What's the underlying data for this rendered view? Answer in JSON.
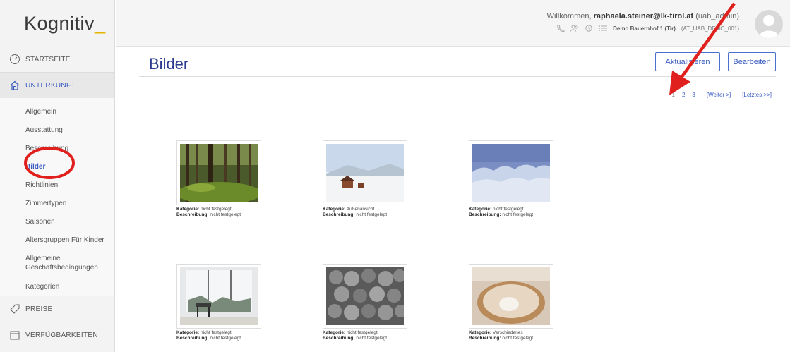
{
  "app": {
    "logo_text": "Kognitiv",
    "logo_accent": "_"
  },
  "sidebar": {
    "main_items": [
      {
        "label": "STARTSEITE",
        "icon": "gauge-icon"
      },
      {
        "label": "UNTERKUNFT",
        "icon": "home-icon"
      }
    ],
    "sub_items": [
      "Allgemein",
      "Ausstattung",
      "Beschreibung",
      "Bilder",
      "Richtlinien",
      "Zimmertypen",
      "Saisonen",
      "Altersgruppen Für Kinder",
      "Allgemeine Geschäftsbedingungen",
      "Kategorien"
    ],
    "bottom_items": [
      {
        "label": "PREISE",
        "icon": "tag-icon"
      },
      {
        "label": "VERFÜGBARKEITEN",
        "icon": "calendar-icon"
      }
    ],
    "active_sub": "Bilder"
  },
  "header": {
    "welcome_prefix": "Willkommen, ",
    "user_email": "raphaela.steiner@lk-tirol.at",
    "user_role": " (uab_admin)",
    "farm_name": "Demo Bauernhof 1 (Tir)",
    "farm_code": "(AT_UAB_DEMO_001)"
  },
  "page": {
    "title": "Bilder",
    "btn_refresh": "Aktualisieren",
    "btn_edit": "Bearbeiten"
  },
  "pagination": {
    "pages": [
      "1",
      "2",
      "3"
    ],
    "next": "[Weiter >]",
    "last": "[Letztes >>]"
  },
  "images": [
    {
      "kategorie_label": "Kategorie:",
      "kategorie": "nicht festgelegt",
      "beschreibung_label": "Beschreibung:",
      "beschreibung": "nicht festgelegt"
    },
    {
      "kategorie_label": "Kategorie:",
      "kategorie": "Außenansicht",
      "beschreibung_label": "Beschreibung:",
      "beschreibung": "nicht festgelegt"
    },
    {
      "kategorie_label": "Kategorie:",
      "kategorie": "nicht festgelegt",
      "beschreibung_label": "Beschreibung:",
      "beschreibung": "nicht festgelegt"
    },
    {
      "kategorie_label": "Kategorie:",
      "kategorie": "nicht festgelegt",
      "beschreibung_label": "Beschreibung:",
      "beschreibung": "nicht festgelegt"
    },
    {
      "kategorie_label": "Kategorie:",
      "kategorie": "nicht festgelegt",
      "beschreibung_label": "Beschreibung:",
      "beschreibung": "nicht festgelegt"
    },
    {
      "kategorie_label": "Kategorie:",
      "kategorie": "Verschiedenes",
      "beschreibung_label": "Beschreibung:",
      "beschreibung": "nicht festgelegt"
    }
  ],
  "colors": {
    "accent": "#3a5bbf",
    "title": "#2a3a8f",
    "annotation": "#e0201c",
    "logo_accent": "#e6b400"
  }
}
